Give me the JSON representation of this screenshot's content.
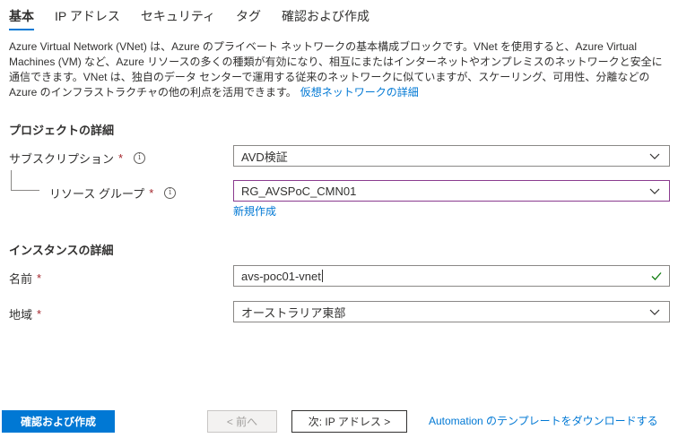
{
  "tabs": [
    {
      "label": "基本",
      "active": true
    },
    {
      "label": "IP アドレス",
      "active": false
    },
    {
      "label": "セキュリティ",
      "active": false
    },
    {
      "label": "タグ",
      "active": false
    },
    {
      "label": "確認および作成",
      "active": false
    }
  ],
  "intro": {
    "text": "Azure Virtual Network (VNet) は、Azure のプライベート ネットワークの基本構成ブロックです。VNet を使用すると、Azure Virtual Machines (VM) など、Azure リソースの多くの種類が有効になり、相互にまたはインターネットやオンプレミスのネットワークと安全に通信できます。VNet は、独自のデータ センターで運用する従来のネットワークに似ていますが、スケーリング、可用性、分離などの Azure のインフラストラクチャの他の利点を活用できます。",
    "link": "仮想ネットワークの詳細"
  },
  "project": {
    "title": "プロジェクトの詳細",
    "subscription_label": "サブスクリプション",
    "subscription_value": "AVD検証",
    "resource_group_label": "リソース グループ",
    "resource_group_value": "RG_AVSPoC_CMN01",
    "new_link": "新規作成"
  },
  "instance": {
    "title": "インスタンスの詳細",
    "name_label": "名前",
    "name_value": "avs-poc01-vnet",
    "region_label": "地域",
    "region_value": "オーストラリア東部"
  },
  "required_mark": "*",
  "info_glyph": "i",
  "footer": {
    "review_button": "確認および作成",
    "prev_button": "< 前へ",
    "next_button": "次: IP アドレス >",
    "template_link": "Automation のテンプレートをダウンロードする"
  },
  "colors": {
    "accent": "#0078d4",
    "required": "#a4262c",
    "valid": "#107c10",
    "focus_border": "#8a3b8f"
  }
}
